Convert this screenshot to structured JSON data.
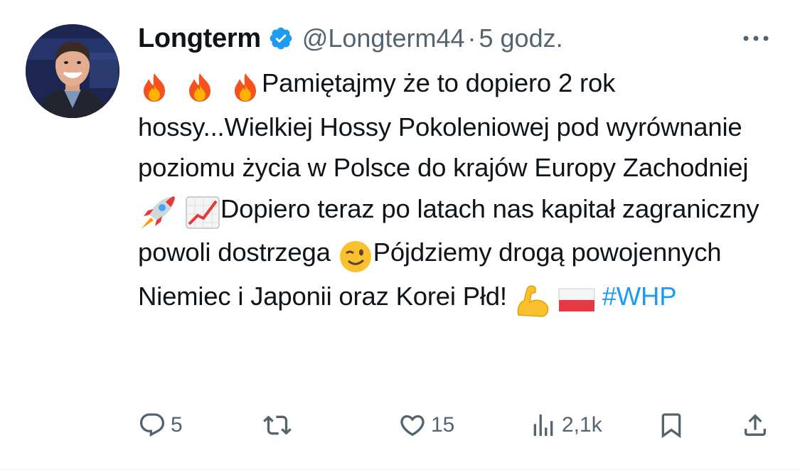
{
  "tweet": {
    "author": {
      "display_name": "Longterm",
      "handle": "@Longterm44",
      "verified": true,
      "avatar_icon": "avatar-photo"
    },
    "separator": "·",
    "timestamp": "5 godz.",
    "more_icon": "more-horizontal-icon",
    "text": {
      "part1": "Pamiętajmy że to dopiero 2 rok hossy...Wielkiej Hossy Pokoleniowej pod wyrównanie poziomu życia w Polsce do krajów Europy Zachodniej",
      "part2": "Dopiero teraz po latach nas kapitał zagraniczny powoli dostrzega",
      "part3": "Pójdziemy drogą powojennych Niemiec i Japonii oraz Korei Płd!",
      "hashtag": "#WHP"
    },
    "emojis": [
      "fire",
      "fire",
      "fire",
      "rocket",
      "chart-increasing",
      "winking-face",
      "flexed-biceps",
      "flag-poland"
    ],
    "accent_color": "#1d9bf0",
    "muted_color": "#536471",
    "actions": {
      "reply_count": "5",
      "repost_count": "",
      "like_count": "15",
      "views_count": "2,1k"
    }
  }
}
